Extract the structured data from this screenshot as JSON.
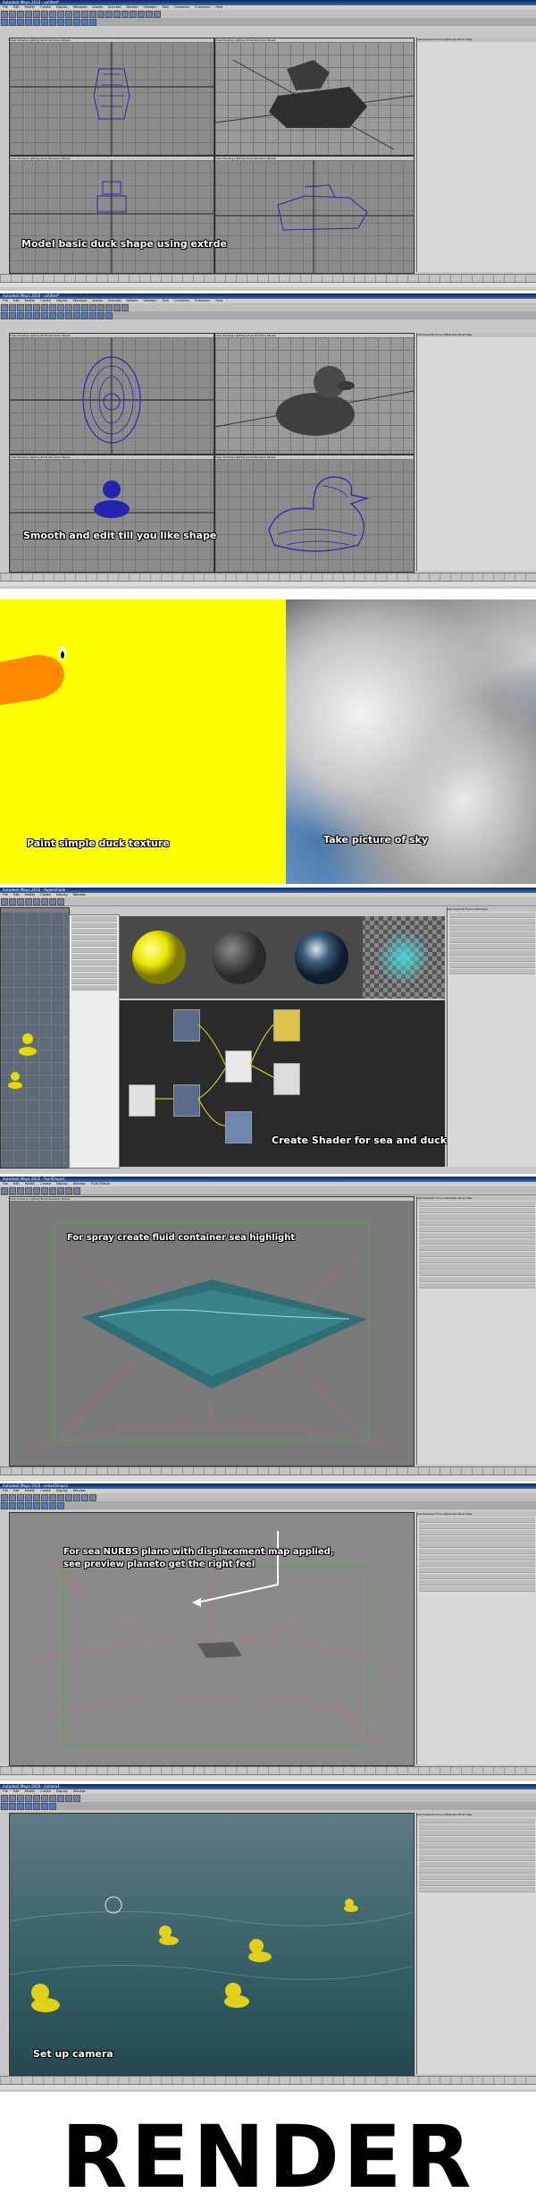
{
  "panels": {
    "p1": {
      "title": "Autodesk Maya 2016 - untitled*",
      "menus": [
        "File",
        "Edit",
        "Modify",
        "Create",
        "Display",
        "Windows",
        "Assets",
        "Animate",
        "Deform",
        "Skeleton",
        "Skin",
        "Constrain",
        "Character",
        "Help"
      ],
      "caption": "Model basic duck shape using extrde"
    },
    "p2": {
      "title": "Autodesk Maya 2016 - untitled*",
      "menus": [
        "File",
        "Edit",
        "Modify",
        "Create",
        "Display",
        "Windows",
        "Assets",
        "Animate",
        "Deform",
        "Skeleton",
        "Skin",
        "Constrain",
        "Character",
        "Help"
      ],
      "caption": "Smooth and edit till you like shape"
    },
    "p3": {
      "caption_left": "Paint simple duck texture",
      "caption_right": "Take picture of sky"
    },
    "p4": {
      "title": "Autodesk Maya 2016 - Hypershade",
      "caption": "Create Shader for sea and duck"
    },
    "p5": {
      "title": "Autodesk Maya 2016 - fluidShape1",
      "caption": "For spray create fluid container sea highlight"
    },
    "p6": {
      "title": "Autodesk Maya 2016 - oceanShape1",
      "caption_line1": "For sea NURBS plane with displacement map applied,",
      "caption_line2": "see preview planeto get the right feel"
    },
    "p7": {
      "title": "Autodesk Maya 2016 - camera1",
      "caption": "Set up camera"
    }
  },
  "render_label": "RENDER",
  "colors": {
    "title_bar": "#0a246a",
    "viewport": "#8c8c8c",
    "yellow": "#ffff00",
    "orange": "#ff8a00",
    "sea": "#2f6a6e"
  }
}
